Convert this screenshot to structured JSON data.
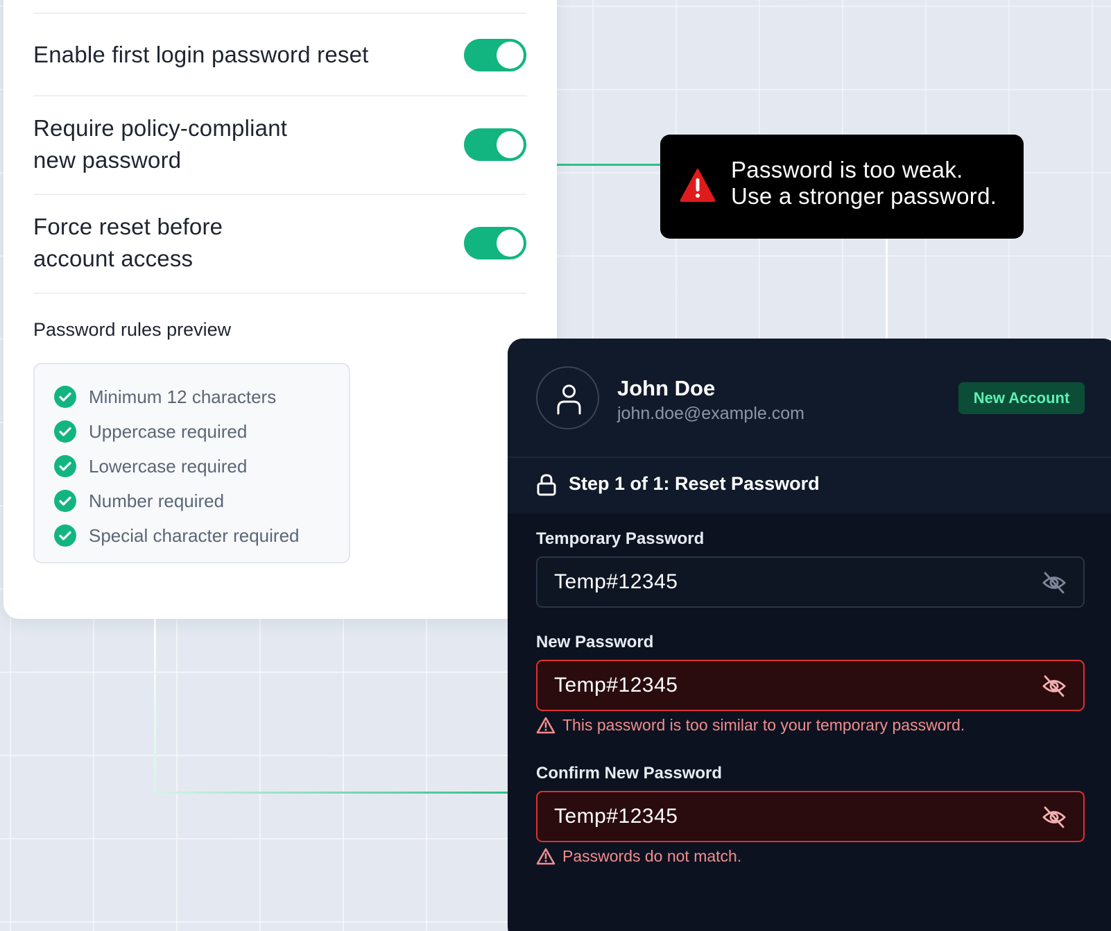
{
  "settings": {
    "rows": [
      {
        "label_line1": "Enable first login password reset",
        "label_line2": "",
        "enabled": true
      },
      {
        "label_line1": "Require policy-compliant",
        "label_line2": "new password",
        "enabled": true
      },
      {
        "label_line1": "Force reset before",
        "label_line2": "account access",
        "enabled": true
      }
    ],
    "rules_title": "Password rules preview",
    "rules": [
      "Minimum 12 characters",
      "Uppercase required",
      "Lowercase required",
      "Number required",
      "Special character required"
    ]
  },
  "tooltip": {
    "line1": "Password is too weak.",
    "line2": "Use a stronger password.",
    "icon": "warning-triangle-icon"
  },
  "card": {
    "user": {
      "name": "John Doe",
      "email": "john.doe@example.com",
      "badge": "New Account"
    },
    "step_title": "Step 1 of 1: Reset Password",
    "fields": {
      "temporary": {
        "label": "Temporary Password",
        "value": "Temp#12345"
      },
      "new": {
        "label": "New Password",
        "value": "Temp#12345",
        "error": "This password is too similar to your temporary password."
      },
      "confirm": {
        "label": "Confirm New Password",
        "value": "Temp#12345",
        "error": "Passwords do not match."
      }
    }
  },
  "colors": {
    "accent": "#12b57f",
    "error": "#dc3131",
    "card_bg": "#0c1220",
    "badge_bg": "#0c4d38",
    "badge_text": "#5ef0b2"
  }
}
